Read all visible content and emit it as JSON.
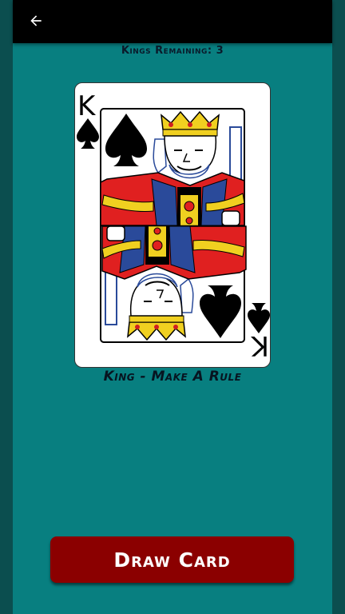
{
  "header": {
    "back_icon": "arrow-left-icon"
  },
  "game": {
    "kings_remaining": "Kings Remaining: 3",
    "card_rank": "K",
    "card_suit": "spades",
    "card_text": "King - Make A Rule"
  },
  "actions": {
    "draw_label": "Draw Card"
  },
  "colors": {
    "background": "#087f80",
    "topbar": "#000000",
    "button": "#8b0000",
    "button_text": "#ffffff"
  }
}
